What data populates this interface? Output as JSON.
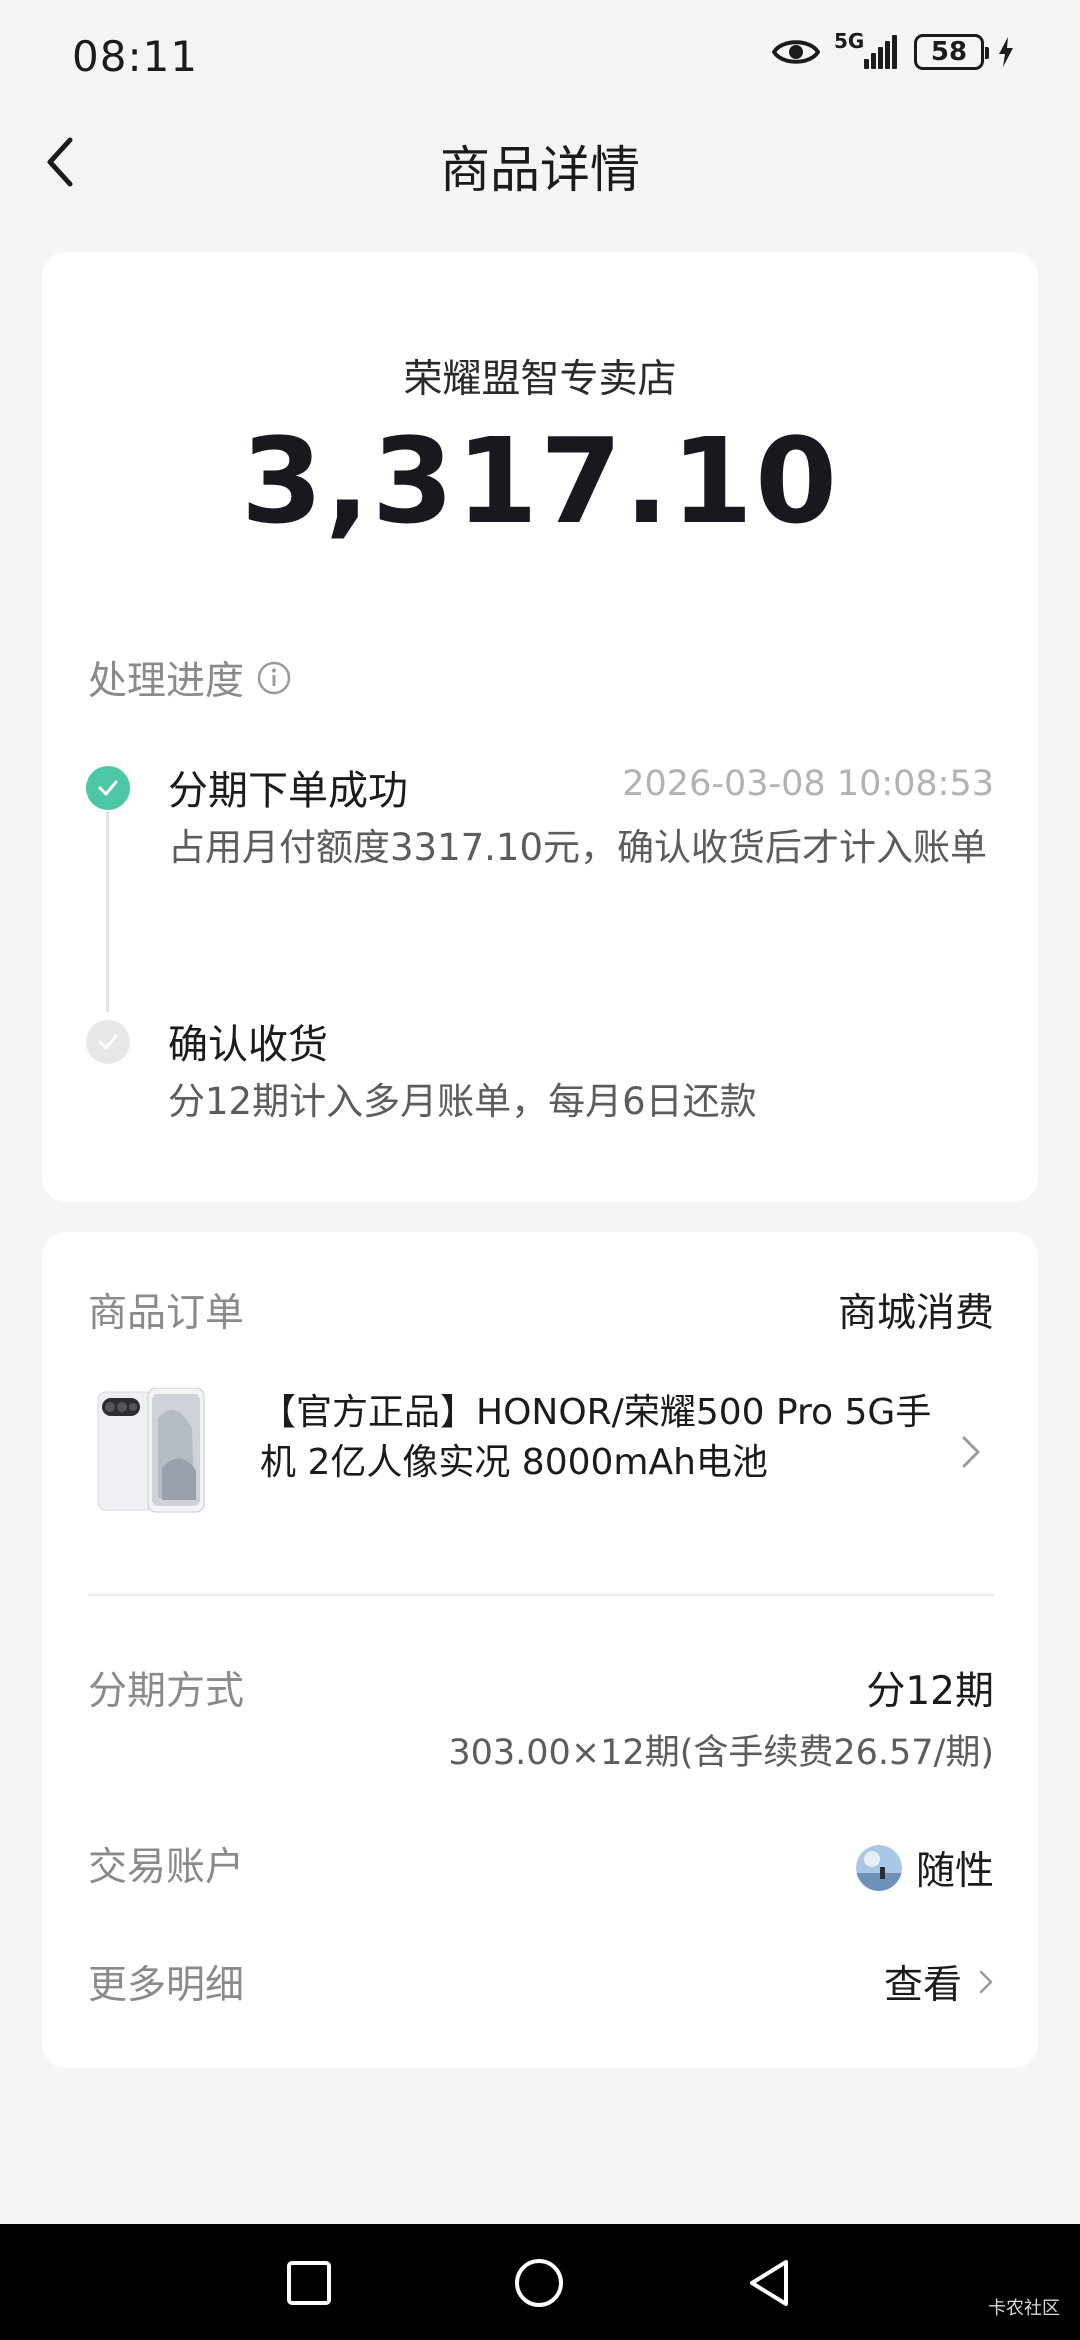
{
  "status_bar": {
    "time": "08:11",
    "network": "5G",
    "battery": "58"
  },
  "header": {
    "title": "商品详情",
    "back_icon": "chevron-left-icon"
  },
  "summary": {
    "merchant": "荣耀盟智专卖店",
    "amount": "3,317.10"
  },
  "progress": {
    "heading": "处理进度",
    "steps": [
      {
        "title": "分期下单成功",
        "time": "2026-03-08 10:08:53",
        "desc": "占用月付额度3317.10元，确认收货后才计入账单",
        "state": "done"
      },
      {
        "title": "确认收货",
        "desc": "分12期计入多月账单，每月6日还款",
        "state": "pending"
      }
    ],
    "done_color": "#4dc7a6"
  },
  "order": {
    "heading": "商品订单",
    "type": "商城消费",
    "product_title": "【官方正品】HONOR/荣耀500 Pro 5G手机 2亿人像实况 8000mAh电池",
    "installment_label": "分期方式",
    "installment_value": "分12期",
    "installment_detail": "303.00×12期(含手续费26.57/期)",
    "account_label": "交易账户",
    "account_value": "随性",
    "more_label": "更多明细",
    "more_value": "查看"
  },
  "nav": {
    "watermark": "卡农社区"
  }
}
